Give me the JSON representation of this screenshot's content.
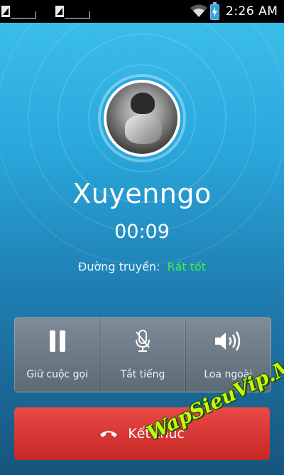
{
  "status_bar": {
    "time": "2:26 AM",
    "icons": [
      "sim-1-icon",
      "sim-2-icon",
      "wifi-icon",
      "battery-charging-icon"
    ]
  },
  "call": {
    "contact_name": "Xuyenngo",
    "duration": "00:09",
    "quality_label": "Đường truyền:",
    "quality_value": "Rất tốt",
    "quality_color": "#3ff04a"
  },
  "controls": [
    {
      "label": "Giữ cuộc gọi",
      "icon": "pause-icon"
    },
    {
      "label": "Tắt tiếng",
      "icon": "microphone-mute-icon"
    },
    {
      "label": "Loa ngoài",
      "icon": "speaker-icon"
    }
  ],
  "end_call": {
    "label": "Kết thúc",
    "icon": "hang-up-icon",
    "color": "#d9322f"
  },
  "watermark": "WapSieuVip.Me"
}
